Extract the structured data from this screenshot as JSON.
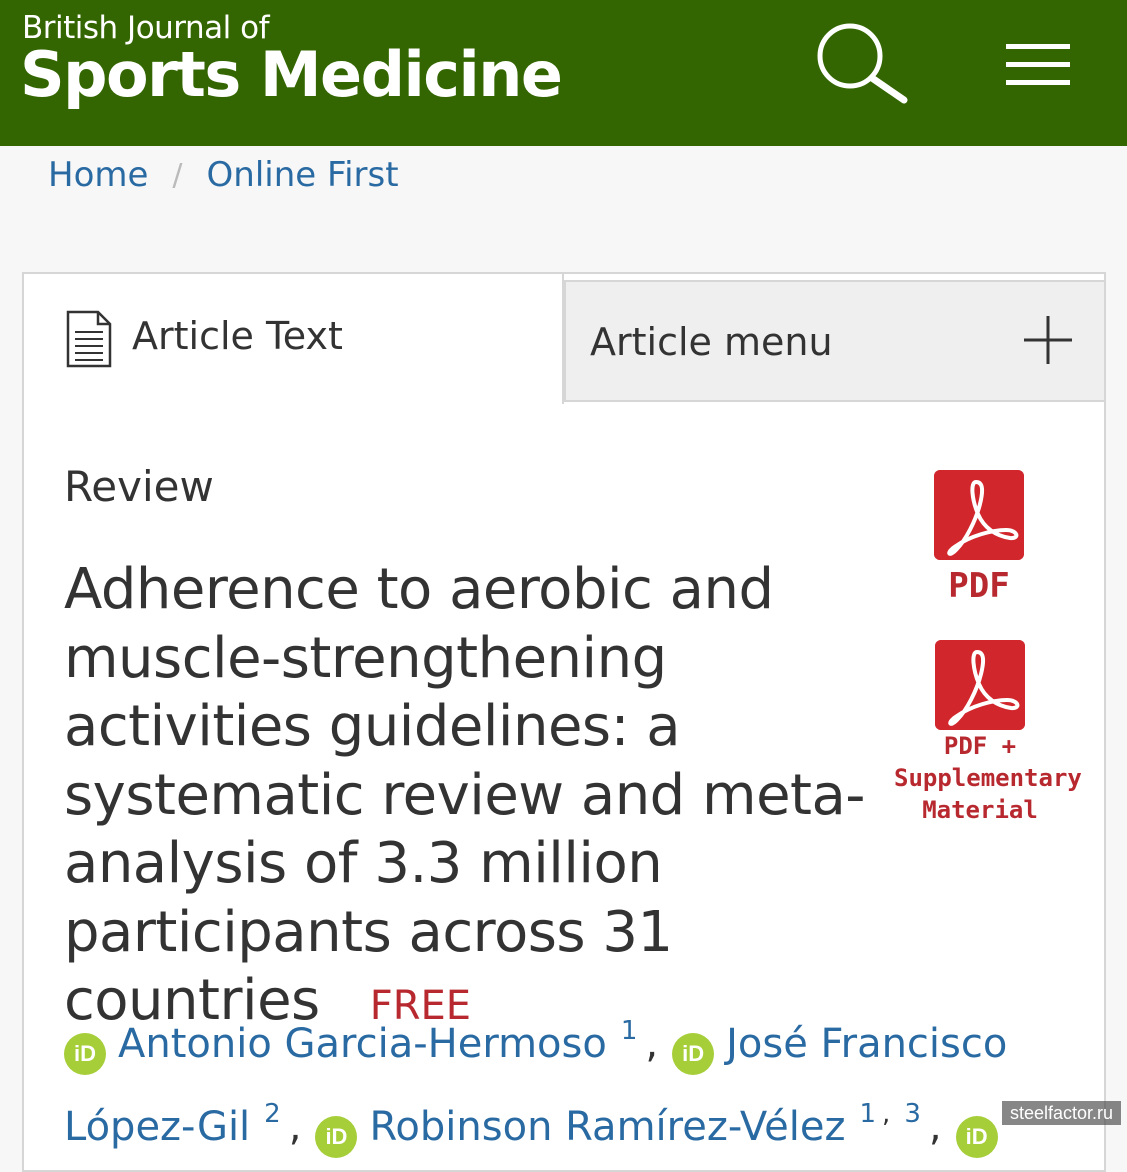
{
  "header": {
    "brand_small": "British Journal of",
    "brand_large": "Sports Medicine",
    "bg_color": "#336600",
    "search_icon": "search-icon",
    "menu_icon": "hamburger-menu-icon"
  },
  "breadcrumb": {
    "home": "Home",
    "separator": "/",
    "current": "Online First"
  },
  "tabs": {
    "article_text": "Article Text",
    "article_menu": "Article menu"
  },
  "article": {
    "type": "Review",
    "title": "Adherence to aerobic and muscle-strengthening activities guidelines: a systematic review and meta-analysis of 3.3 million participants across 31 countries",
    "free_label": "FREE"
  },
  "downloads": {
    "pdf_label": "PDF",
    "pdf_supp_line1": "PDF +",
    "pdf_supp_line2": "Supplementary",
    "pdf_supp_line3": "Material"
  },
  "authors": [
    {
      "name": "Antonio Garcia-Hermoso",
      "aff": "1"
    },
    {
      "name_line1": "José Francisco",
      "name_line2": "López-Gil",
      "aff": "2"
    },
    {
      "name": "Robinson Ramírez-Vélez",
      "aff1": "1",
      "aff_sep": ",",
      "aff2": "3"
    }
  ],
  "orcid_label": "iD",
  "watermark": "steelfactor.ru"
}
